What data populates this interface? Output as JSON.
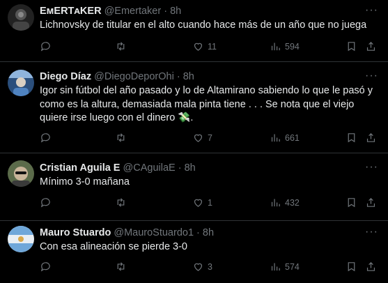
{
  "tweets": [
    {
      "name": "EᴍERTᴀKER",
      "handle": "@Emertaker",
      "time": "8h",
      "separator": "·",
      "text_lines": [
        "Lichnovsky de titular en el alto cuando hace más de un año que no juega"
      ],
      "likes": "11",
      "views": "594",
      "avatar_colors": [
        "#1a1a1a",
        "#3b3b3b"
      ]
    },
    {
      "name": "Diego Díaz",
      "handle": "@DiegoDeporOhi",
      "time": "8h",
      "separator": "·",
      "text_lines": [
        "Igor sin fútbol del año pasado y lo de Altamirano sabiendo lo que le pasó y",
        "como es la altura, demasiada mala pinta tiene . . . Se nota que el viejo",
        "quiere irse luego con el dinero 💸."
      ],
      "likes": "7",
      "views": "661",
      "avatar_colors": [
        "#3a6fa8",
        "#d9d9d9"
      ]
    },
    {
      "name": "Cristian Aguila E",
      "handle": "@CAguilaE",
      "time": "8h",
      "separator": "·",
      "text_lines": [
        "Mínimo 3-0 mañana"
      ],
      "likes": "1",
      "views": "432",
      "avatar_colors": [
        "#7a8c6a",
        "#c9b59a"
      ]
    },
    {
      "name": "Mauro Stuardo",
      "handle": "@MauroStuardo1",
      "time": "8h",
      "separator": "·",
      "text_lines": [
        "Con esa alineación se pierde 3-0"
      ],
      "likes": "3",
      "views": "574",
      "avatar_colors": [
        "#6fa7d9",
        "#e8eef3"
      ]
    }
  ],
  "icons": {
    "reply": "reply-icon",
    "retweet": "retweet-icon",
    "like": "heart-icon",
    "views": "views-icon",
    "bookmark": "bookmark-icon",
    "share": "share-icon",
    "more": "more-icon"
  },
  "more_glyph": "···"
}
